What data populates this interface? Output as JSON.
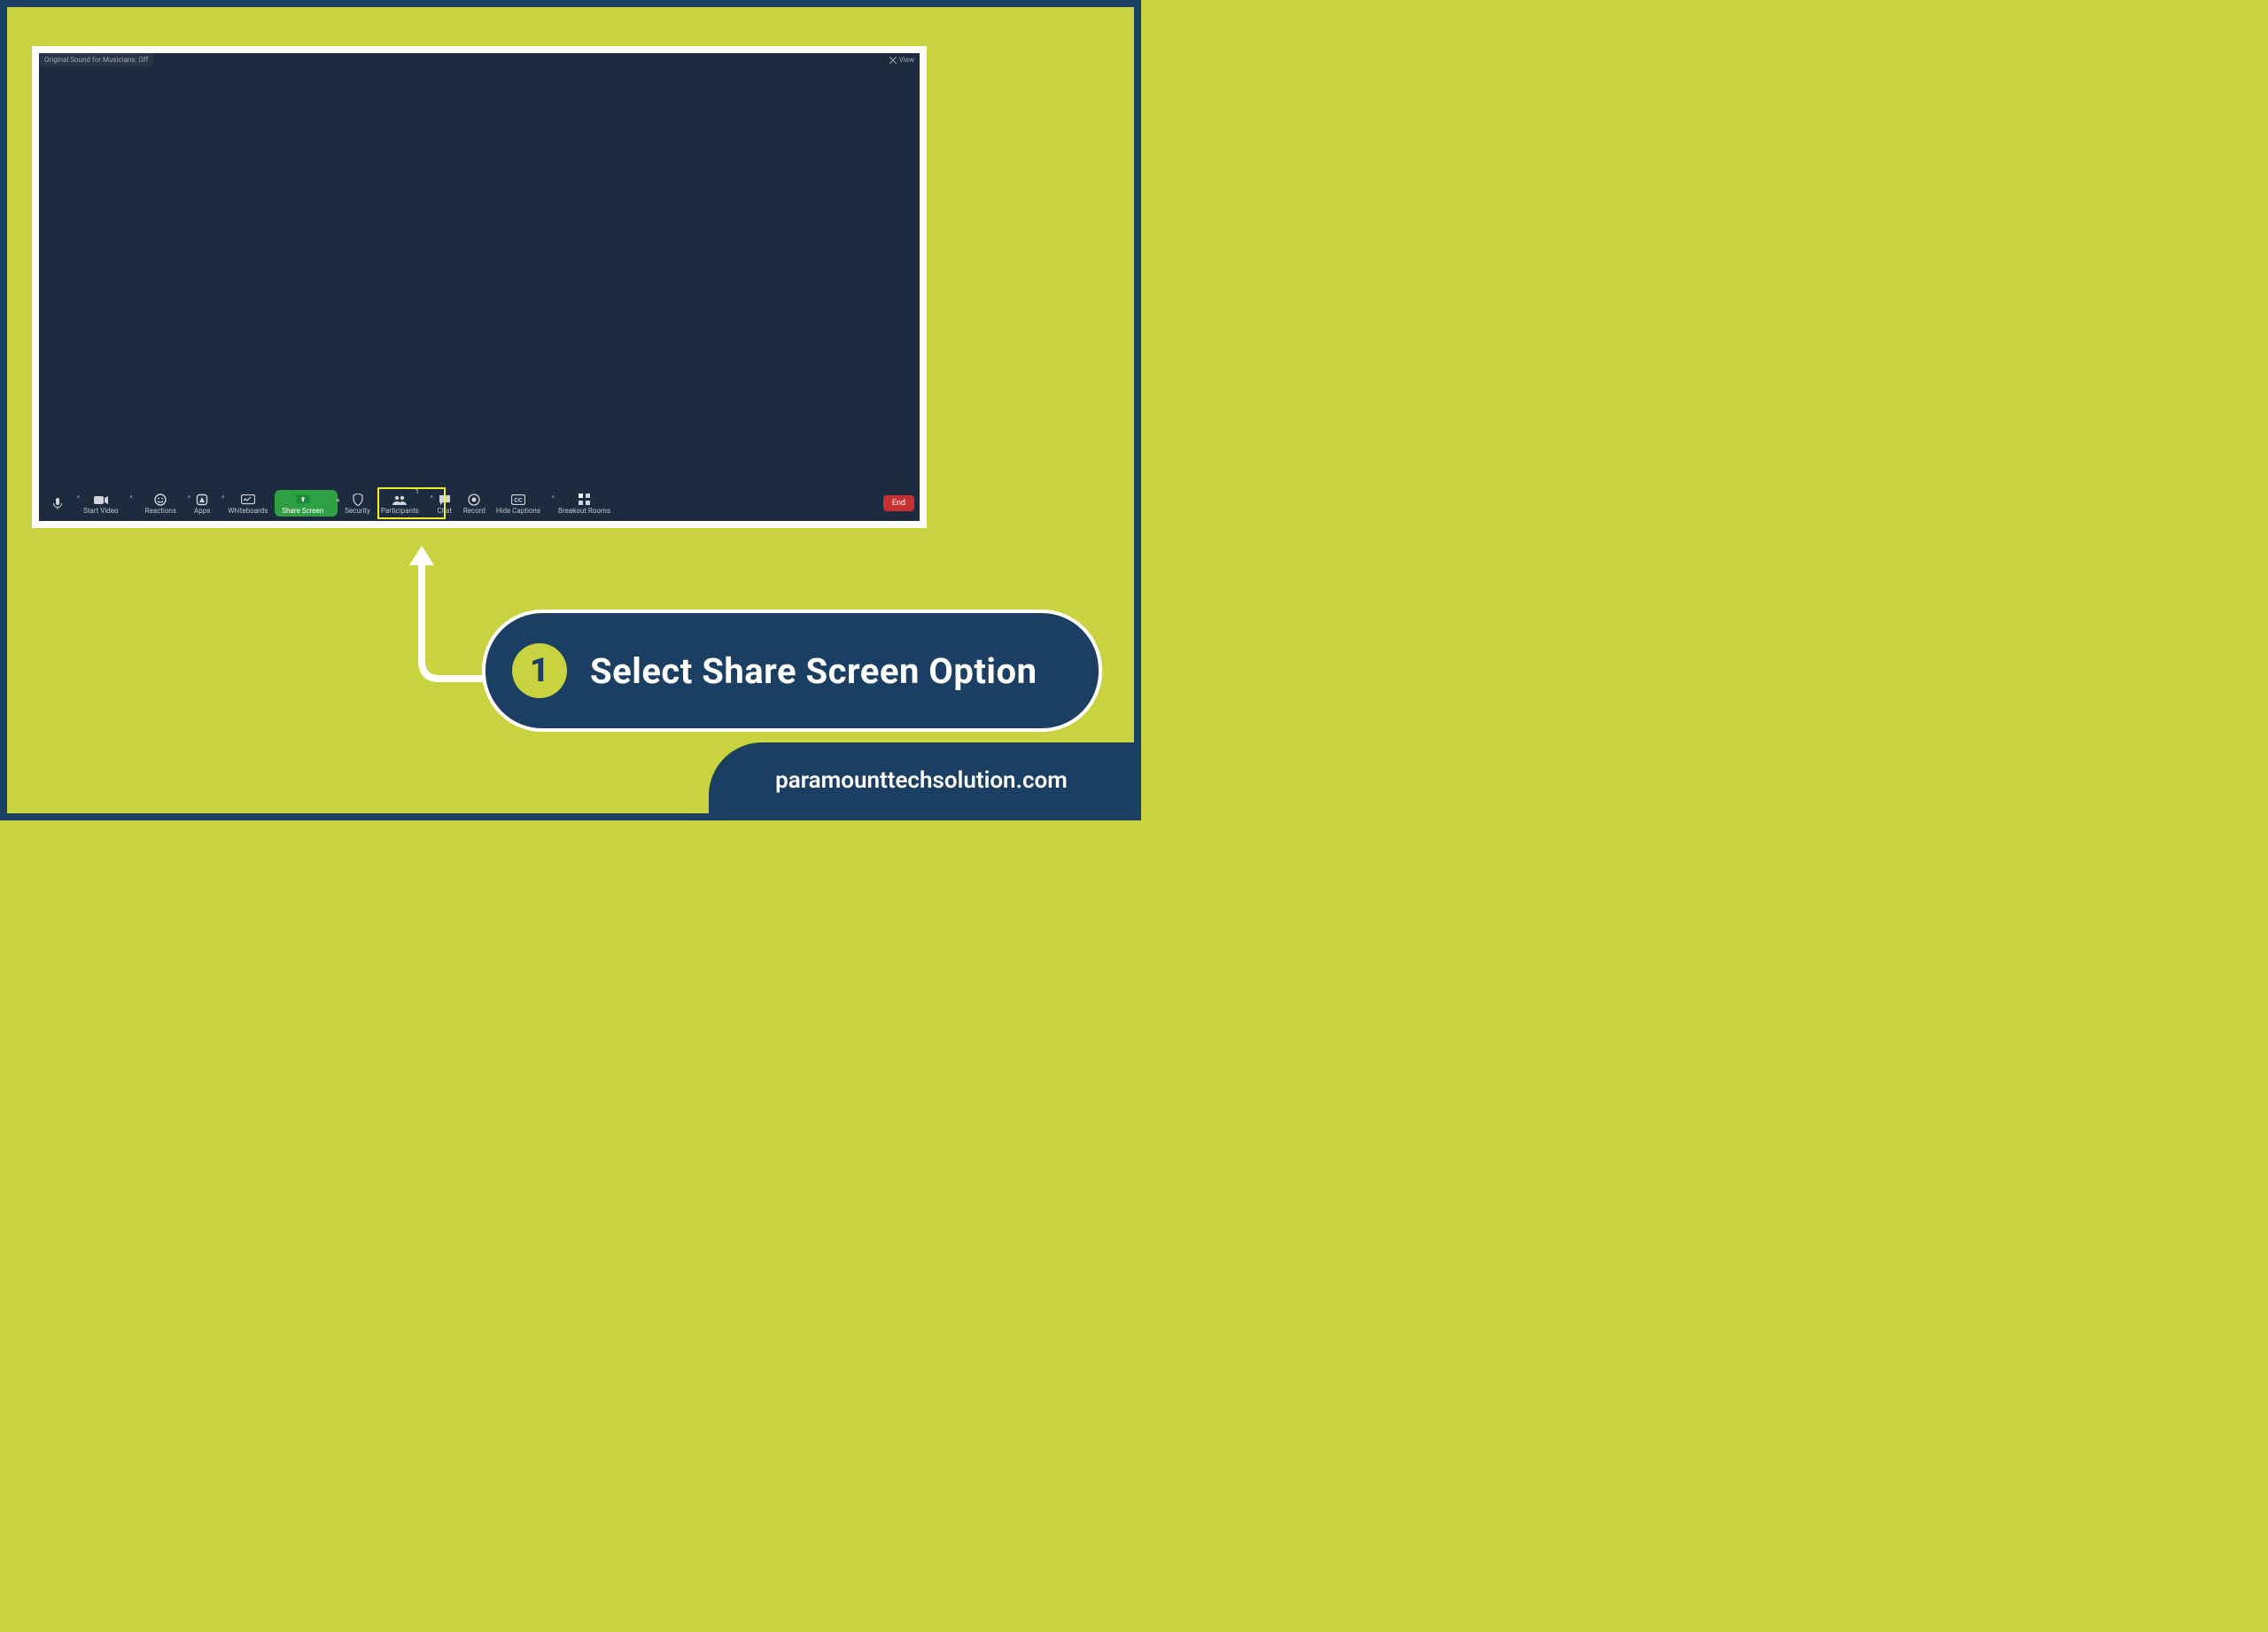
{
  "top": {
    "left_label": "Original Sound for Musicians: Off",
    "view_label": "View"
  },
  "toolbar": {
    "mute": {
      "label": ""
    },
    "start_video": {
      "label": "Start Video"
    },
    "reactions": {
      "label": "Reactions"
    },
    "apps": {
      "label": "Apps"
    },
    "whiteboards": {
      "label": "Whiteboards"
    },
    "share_screen": {
      "label": "Share Screen"
    },
    "security": {
      "label": "Security"
    },
    "participants": {
      "label": "Participants",
      "count": "1"
    },
    "chat": {
      "label": "Chat"
    },
    "record": {
      "label": "Record"
    },
    "hide_captions": {
      "label": "Hide Captions"
    },
    "breakout_rooms": {
      "label": "Breakout Rooms"
    },
    "more": {
      "label": ""
    },
    "end": {
      "label": "End"
    }
  },
  "callout": {
    "number": "1",
    "text": "Select Share Screen Option"
  },
  "footer": {
    "text": "paramounttechsolution.com"
  }
}
